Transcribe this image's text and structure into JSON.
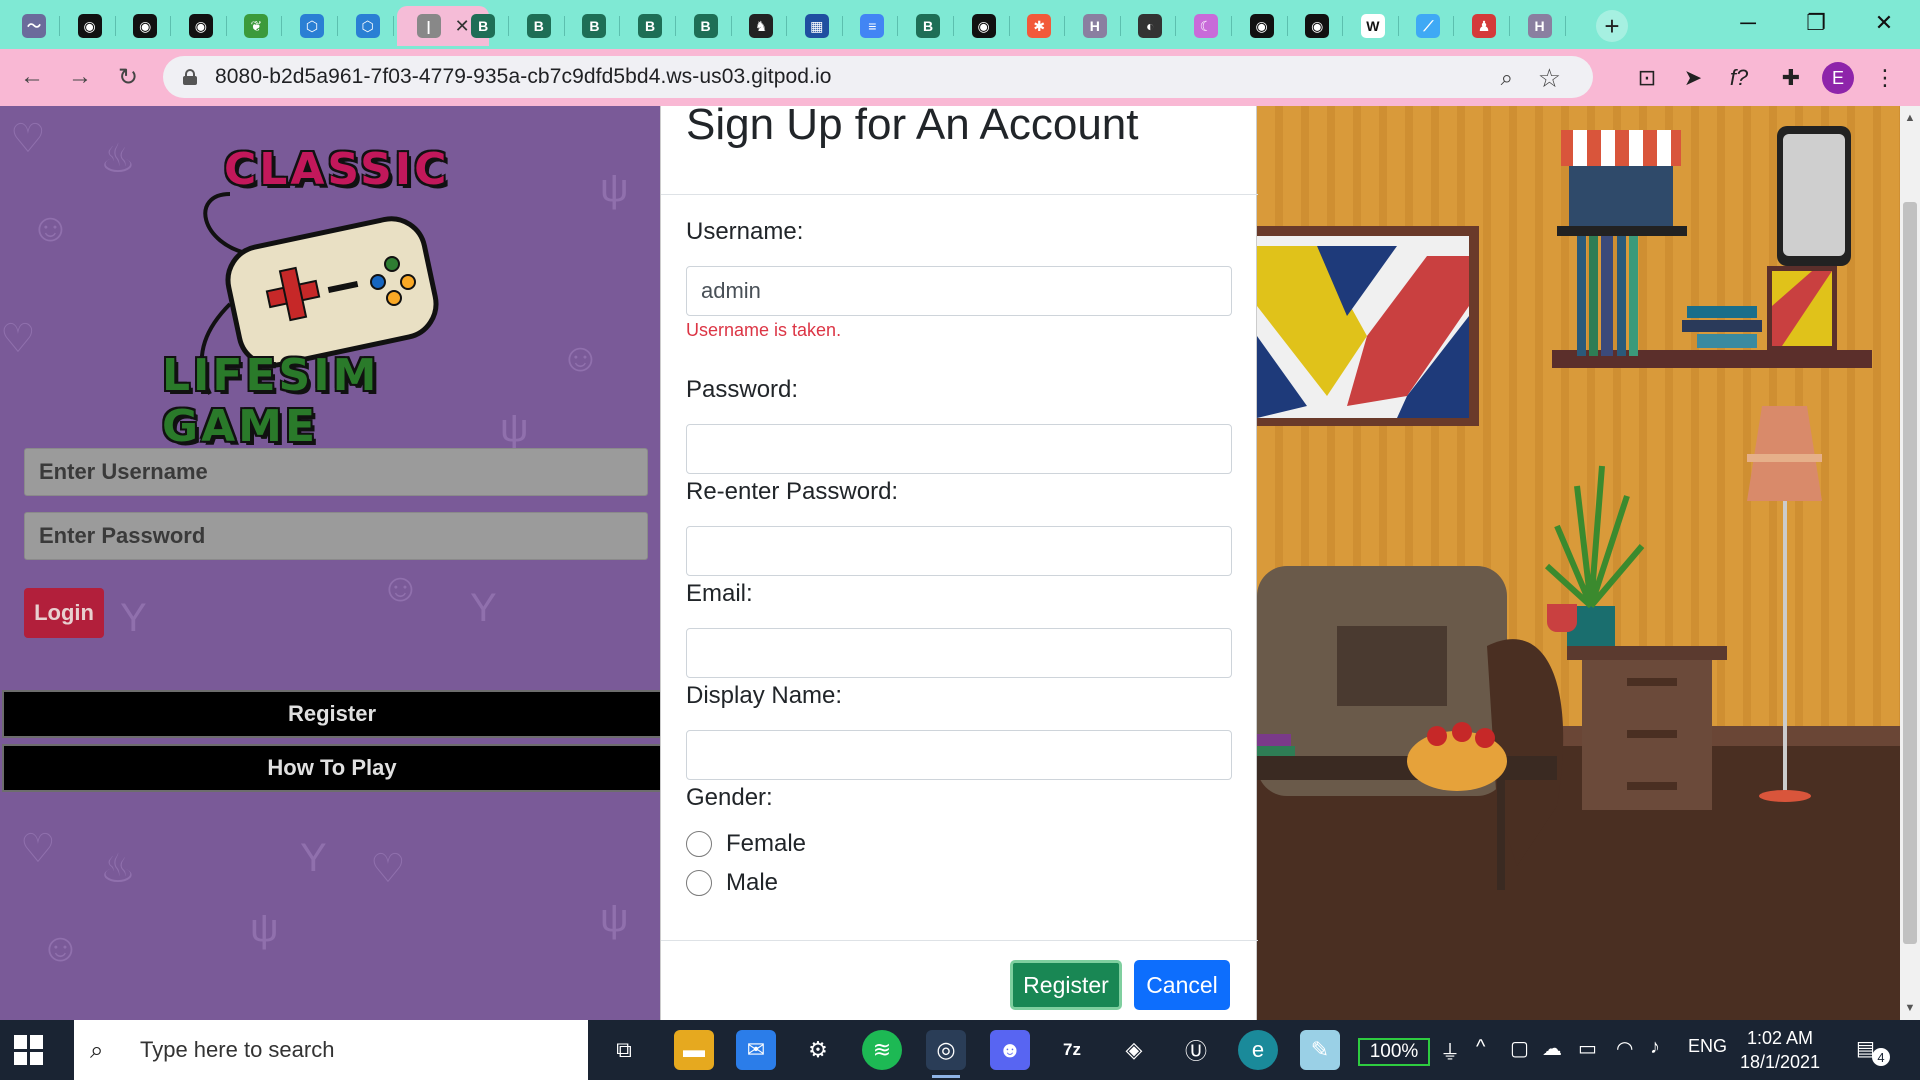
{
  "browser": {
    "url": "8080-b2d5a961-7f03-4779-935a-cb7c9dfd5bd4.ws-us03.gitpod.io",
    "tabs": [
      {
        "icon": "blob-icon",
        "color": "#6b6b9b",
        "glyph": "〜"
      },
      {
        "icon": "github-icon",
        "color": "#111111",
        "glyph": "◉"
      },
      {
        "icon": "github-icon",
        "color": "#111111",
        "glyph": "◉"
      },
      {
        "icon": "github-icon",
        "color": "#111111",
        "glyph": "◉"
      },
      {
        "icon": "leaf-icon",
        "color": "#3b9a3b",
        "glyph": "❦"
      },
      {
        "icon": "hexagon-icon",
        "color": "#2a7fd4",
        "glyph": "⬡"
      },
      {
        "icon": "hexagon-icon",
        "color": "#2a7fd4",
        "glyph": "⬡"
      },
      {
        "icon": "blank-icon",
        "color": "#888888",
        "glyph": "|"
      },
      {
        "icon": "vue-b-icon",
        "color": "#1e6e56",
        "glyph": "B"
      },
      {
        "icon": "vue-b-icon",
        "color": "#1e6e56",
        "glyph": "B"
      },
      {
        "icon": "vue-b-icon",
        "color": "#1e6e56",
        "glyph": "B"
      },
      {
        "icon": "vue-b-icon",
        "color": "#1e6e56",
        "glyph": "B"
      },
      {
        "icon": "vue-b-icon",
        "color": "#1e6e56",
        "glyph": "B"
      },
      {
        "icon": "game-icon",
        "color": "#222222",
        "glyph": "♞"
      },
      {
        "icon": "chart-icon",
        "color": "#1f4fa0",
        "glyph": "▦"
      },
      {
        "icon": "docs-icon",
        "color": "#4285f4",
        "glyph": "≡"
      },
      {
        "icon": "vue-b-icon",
        "color": "#1e6e56",
        "glyph": "B"
      },
      {
        "icon": "github-icon",
        "color": "#111111",
        "glyph": "◉"
      },
      {
        "icon": "asterisk-icon",
        "color": "#f25a3b",
        "glyph": "✱"
      },
      {
        "icon": "h-icon",
        "color": "#8a7fa0",
        "glyph": "H"
      },
      {
        "icon": "globe-icon",
        "color": "#333333",
        "glyph": "◐"
      },
      {
        "icon": "moon-icon",
        "color": "#c86bd9",
        "glyph": "☾"
      },
      {
        "icon": "github-icon",
        "color": "#111111",
        "glyph": "◉"
      },
      {
        "icon": "github-icon",
        "color": "#111111",
        "glyph": "◉"
      },
      {
        "icon": "wikipedia-icon",
        "color": "#ffffff",
        "glyph": "W"
      },
      {
        "icon": "flutter-icon",
        "color": "#3fa9f5",
        "glyph": "⟋"
      },
      {
        "icon": "figure-icon",
        "color": "#d43a3a",
        "glyph": "♟"
      },
      {
        "icon": "h-icon",
        "color": "#8a7fa0",
        "glyph": "H"
      }
    ],
    "new_tab_label": "+",
    "window_controls": {
      "minimize": "─",
      "restore": "❐",
      "close": "✕"
    }
  },
  "login": {
    "logo_top": "CLASSIC",
    "logo_bottom": "LIFESIM GAME",
    "username_placeholder": "Enter Username",
    "password_placeholder": "Enter Password",
    "login_label": "Login",
    "register_label": "Register",
    "howto_label": "How To Play"
  },
  "modal": {
    "title": "Sign Up for An Account",
    "username_label": "Username:",
    "username_value": "admin",
    "username_error": "Username is taken.",
    "password_label": "Password:",
    "reenter_label": "Re-enter Password:",
    "email_label": "Email:",
    "display_label": "Display Name:",
    "gender_label": "Gender:",
    "gender_options": [
      "Female",
      "Male"
    ],
    "register_label": "Register",
    "cancel_label": "Cancel"
  },
  "taskbar": {
    "search_placeholder": "Type here to search",
    "battery_percent": "100%",
    "language": "ENG",
    "time": "1:02 AM",
    "date": "18/1/2021",
    "notification_count": "4"
  }
}
